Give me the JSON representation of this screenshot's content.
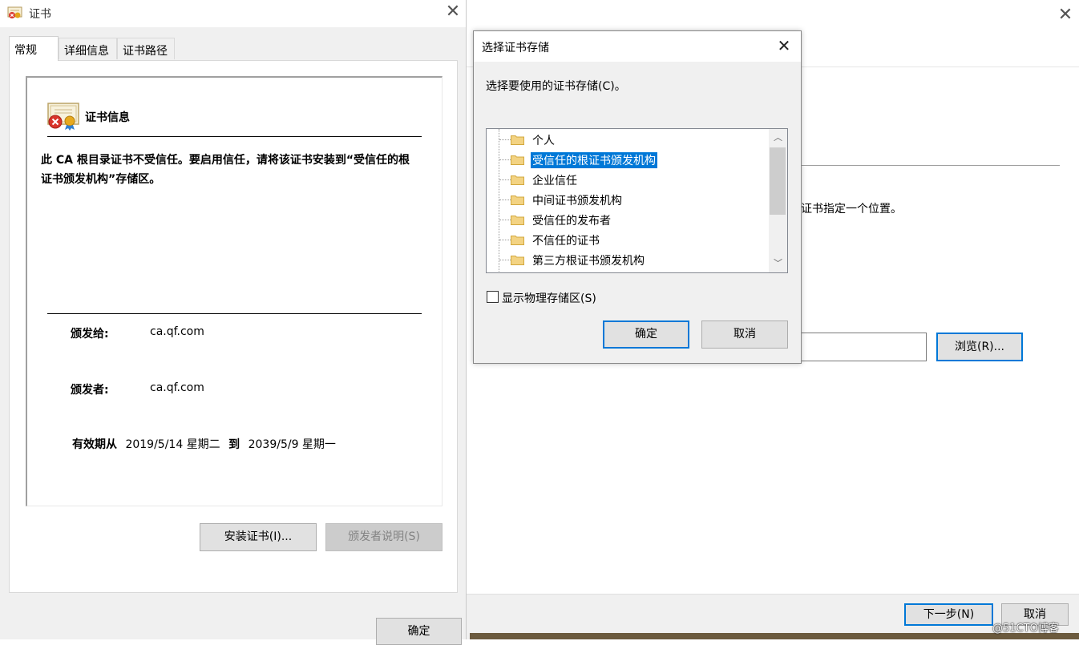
{
  "cert_window": {
    "title": "证书",
    "tabs": [
      {
        "label": "常规"
      },
      {
        "label": "详细信息"
      },
      {
        "label": "证书路径"
      }
    ],
    "info_heading": "证书信息",
    "warning": "此 CA 根目录证书不受信任。要启用信任，请将该证书安装到“受信任的根证书颁发机构”存储区。",
    "issued_to_label": "颁发给:",
    "issued_to_value": "ca.qf.com",
    "issued_by_label": "颁发者:",
    "issued_by_value": "ca.qf.com",
    "validity_label": "有效期从",
    "valid_from": "2019/5/14 星期二",
    "validity_to": "到",
    "valid_to": "2039/5/9 星期一",
    "install_button": "安装证书(I)...",
    "issuer_statement_button": "颁发者说明(S)",
    "ok_button": "确定"
  },
  "wizard": {
    "partial_text": "证书指定一个位置。",
    "browse_button": "浏览(R)...",
    "next_button": "下一步(N)",
    "cancel_button": "取消",
    "watermark": "@51CTO博客"
  },
  "store_dialog": {
    "title": "选择证书存储",
    "prompt": "选择要使用的证书存储(C)。",
    "stores": [
      {
        "label": "个人",
        "selected": false
      },
      {
        "label": "受信任的根证书颁发机构",
        "selected": true
      },
      {
        "label": "企业信任",
        "selected": false
      },
      {
        "label": "中间证书颁发机构",
        "selected": false
      },
      {
        "label": "受信任的发布者",
        "selected": false
      },
      {
        "label": "不信任的证书",
        "selected": false
      },
      {
        "label": "第三方根证书颁发机构",
        "selected": false
      }
    ],
    "show_physical_label": "显示物理存储区(S)",
    "show_physical_checked": false,
    "ok_button": "确定",
    "cancel_button": "取消"
  },
  "icons": {
    "close": "close-icon",
    "folder": "folder-icon",
    "certificate": "certificate-error-icon",
    "scroll_up": "chevron-up-icon",
    "scroll_down": "chevron-down-icon"
  },
  "colors": {
    "accent": "#0078d7",
    "dialog_bg": "#f0f0f0",
    "folder": "#e8c160"
  }
}
